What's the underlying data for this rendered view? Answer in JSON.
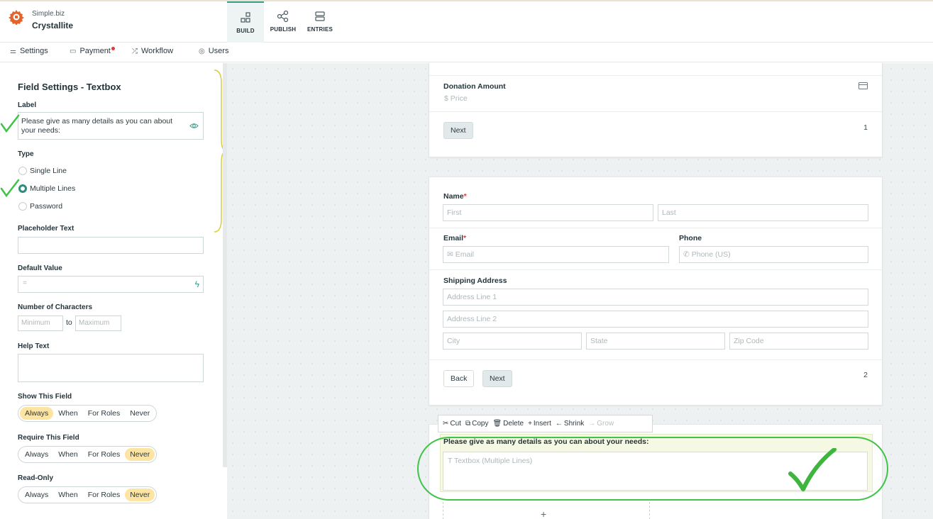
{
  "header": {
    "brand_small": "Simple.biz",
    "brand_name": "Crystallite",
    "tabs": [
      {
        "label": "BUILD",
        "active": true
      },
      {
        "label": "PUBLISH"
      },
      {
        "label": "ENTRIES"
      }
    ]
  },
  "subnav": {
    "items": [
      {
        "label": "Settings",
        "icon": "sliders-icon"
      },
      {
        "label": "Payment",
        "icon": "card-icon",
        "badge": true
      },
      {
        "label": "Workflow",
        "icon": "shuffle-icon"
      },
      {
        "label": "Users",
        "icon": "users-icon"
      }
    ]
  },
  "field_settings": {
    "title": "Field Settings - Textbox",
    "label_heading": "Label",
    "label_value": "Please give as many details as you can about your needs:",
    "type_heading": "Type",
    "type_options": [
      "Single Line",
      "Multiple Lines",
      "Password"
    ],
    "type_selected": "Multiple Lines",
    "placeholder_heading": "Placeholder Text",
    "placeholder_value": "",
    "default_heading": "Default Value",
    "default_value": "=",
    "chars_heading": "Number of Characters",
    "chars_min_placeholder": "Minimum",
    "chars_to": "to",
    "chars_max_placeholder": "Maximum",
    "help_heading": "Help Text",
    "show_heading": "Show This Field",
    "require_heading": "Require This Field",
    "readonly_heading": "Read-Only",
    "segments": [
      "Always",
      "When",
      "For Roles",
      "Never"
    ],
    "show_selected": "Always",
    "require_selected": "Never",
    "readonly_selected": "Never"
  },
  "canvas": {
    "page1": {
      "donation_label": "Donation Amount",
      "price_placeholder": "$ Price",
      "next_label": "Next",
      "page_number": "1"
    },
    "page2": {
      "name_label": "Name",
      "first_placeholder": "First",
      "last_placeholder": "Last",
      "email_label": "Email",
      "email_placeholder": "Email",
      "phone_label": "Phone",
      "phone_placeholder": "Phone (US)",
      "shipping_label": "Shipping Address",
      "address1_placeholder": "Address Line 1",
      "address2_placeholder": "Address Line 2",
      "city_placeholder": "City",
      "state_placeholder": "State",
      "zip_placeholder": "Zip Code",
      "back_label": "Back",
      "next_label": "Next",
      "page_number": "2"
    },
    "toolbar": {
      "cut": "Cut",
      "copy": "Copy",
      "delete": "Delete",
      "insert": "Insert",
      "shrink": "Shrink",
      "grow": "Grow"
    },
    "selected_field": {
      "label": "Please give as many details as you can about your needs:",
      "placeholder": "Textbox (Multiple Lines)"
    }
  },
  "colors": {
    "accent": "#2d8c7e",
    "highlight": "#fde4a3",
    "annotation_green": "#3fc447",
    "bracket_yellow": "#d9cc3a",
    "required": "#e03c31"
  }
}
